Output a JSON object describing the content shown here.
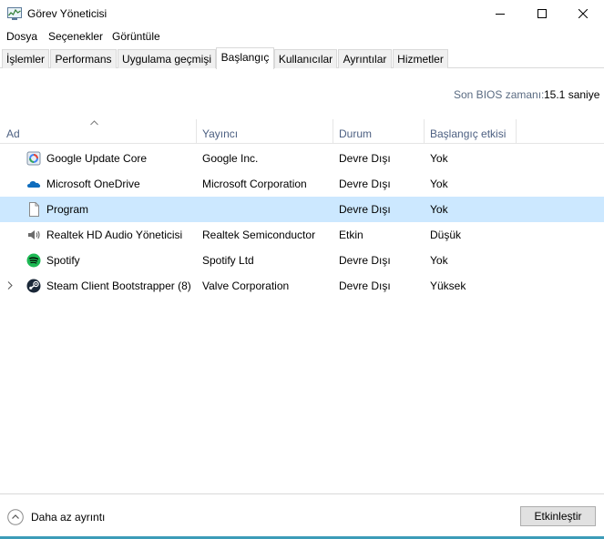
{
  "window": {
    "title": "Görev Yöneticisi"
  },
  "menu": [
    "Dosya",
    "Seçenekler",
    "Görüntüle"
  ],
  "tabs": [
    "İşlemler",
    "Performans",
    "Uygulama geçmişi",
    "Başlangıç",
    "Kullanıcılar",
    "Ayrıntılar",
    "Hizmetler"
  ],
  "active_tab": "Başlangıç",
  "bios": {
    "label": "Son BIOS zamanı:",
    "value": "15.1 saniye"
  },
  "columns": {
    "name": "Ad",
    "publisher": "Yayıncı",
    "status": "Durum",
    "impact": "Başlangıç etkisi"
  },
  "rows": [
    {
      "name": "Google Update Core",
      "publisher": "Google Inc.",
      "status": "Devre Dışı",
      "impact": "Yok",
      "icon": "google-update-icon"
    },
    {
      "name": "Microsoft OneDrive",
      "publisher": "Microsoft Corporation",
      "status": "Devre Dışı",
      "impact": "Yok",
      "icon": "onedrive-icon"
    },
    {
      "name": "Program",
      "publisher": "",
      "status": "Devre Dışı",
      "impact": "Yok",
      "icon": "blank-file-icon",
      "selected": true
    },
    {
      "name": "Realtek HD Audio Yöneticisi",
      "publisher": "Realtek Semiconductor",
      "status": "Etkin",
      "impact": "Düşük",
      "icon": "speaker-icon"
    },
    {
      "name": "Spotify",
      "publisher": "Spotify Ltd",
      "status": "Devre Dışı",
      "impact": "Yok",
      "icon": "spotify-icon"
    },
    {
      "name": "Steam Client Bootstrapper (8)",
      "publisher": "Valve Corporation",
      "status": "Devre Dışı",
      "impact": "Yüksek",
      "icon": "steam-icon",
      "expandable": true
    }
  ],
  "footer": {
    "less_details": "Daha az ayrıntı",
    "enable_button": "Etkinleştir"
  },
  "colors": {
    "selected_row": "#cce8ff",
    "header_text": "#4d6082",
    "accent_bar": "#3c9cb8"
  }
}
